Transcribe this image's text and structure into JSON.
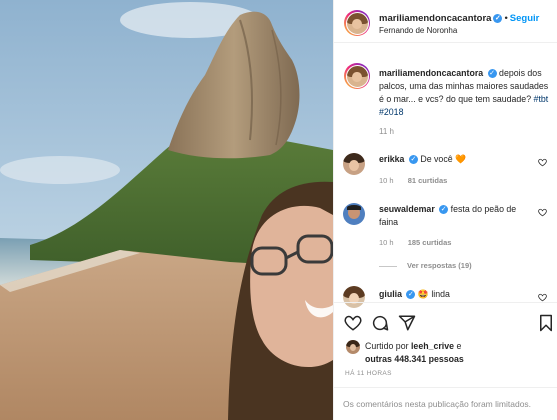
{
  "header": {
    "username": "mariliamendoncacantora",
    "separator": "•",
    "follow_label": "Seguir",
    "location": "Fernando de Noronha"
  },
  "caption": {
    "username": "mariliamendoncacantora",
    "text": "depois dos palcos, uma das minhas maiores saudades é o mar... e vcs? do que tem saudade?",
    "hashtags": "#tbt #2018",
    "time": "11 h"
  },
  "comments": [
    {
      "username": "erikka",
      "text": "De você",
      "emoji": "🧡",
      "time": "10 h",
      "likes": "81 curtidas"
    },
    {
      "username": "seuwaldemar",
      "text": "festa do peão de faina",
      "time": "10 h",
      "likes": "185 curtidas",
      "replies": "Ver respostas (19)"
    },
    {
      "username": "giulia",
      "emoji": "🤩",
      "text": "linda"
    }
  ],
  "likes": {
    "prefix": "Curtido por",
    "user": "leeh_crive",
    "connector": "e",
    "others": "outras 448.341 pessoas"
  },
  "posted_ago": "HÁ 11 HORAS",
  "footer_notice": "Os comentários nesta publicação foram limitados.",
  "icons": [
    "heart-icon",
    "comment-icon",
    "share-icon",
    "bookmark-icon",
    "verified-icon"
  ],
  "colors": {
    "accent": "#0095f6",
    "verified": "#3897f0",
    "hashtag": "#00376b",
    "muted": "#8e8e8e"
  }
}
